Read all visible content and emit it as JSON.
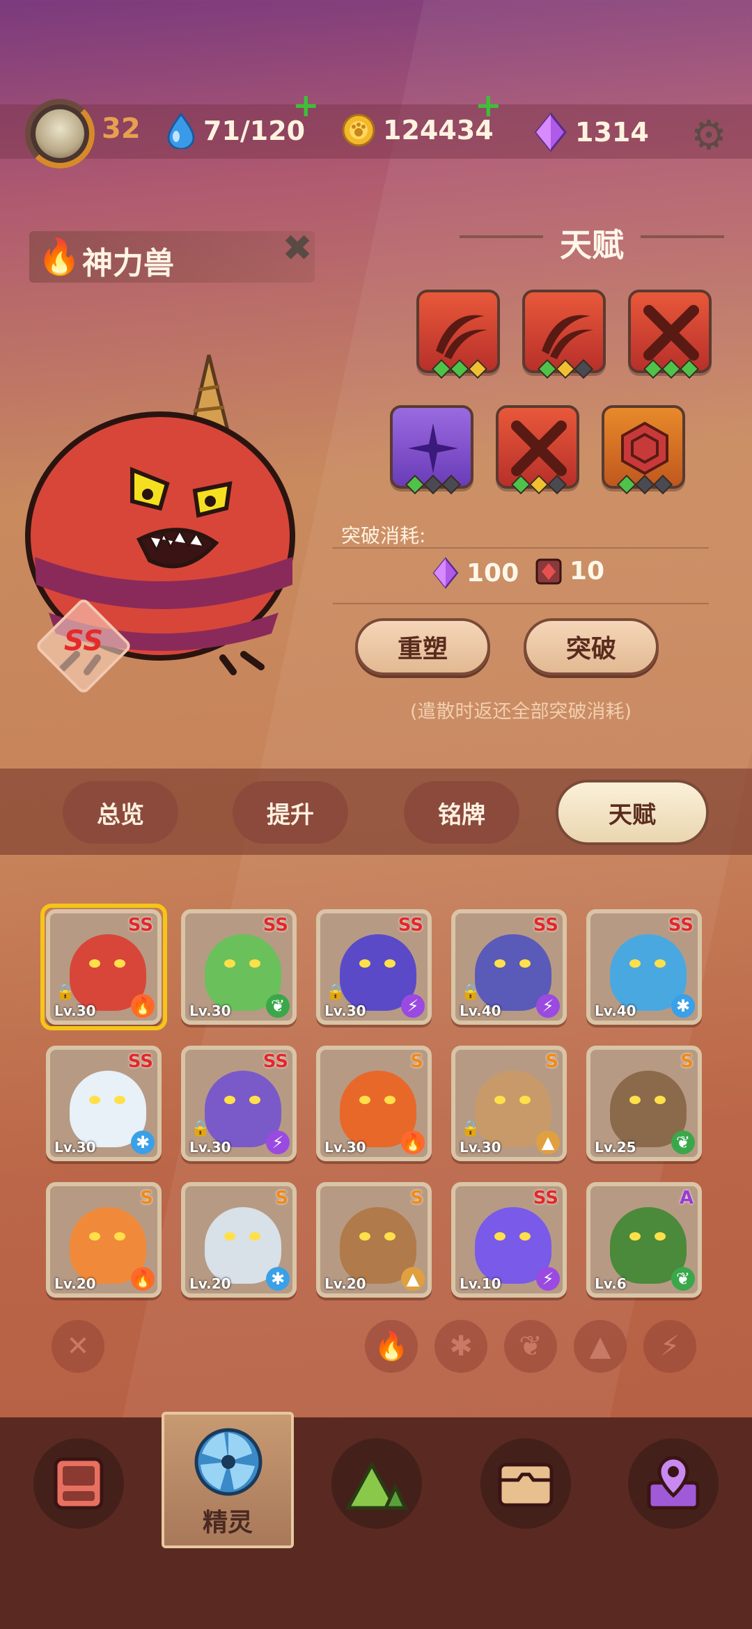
{
  "topbar": {
    "player_level": "32",
    "energy": "71/120",
    "coins": "124434",
    "gems": "1314"
  },
  "monster": {
    "name": "神力兽",
    "grade": "SS"
  },
  "talent": {
    "title": "天赋",
    "cost_label": "突破消耗:",
    "cost_gems": "100",
    "cost_items": "10",
    "reset_button": "重塑",
    "breakthrough_button": "突破",
    "note": "(遣散时返还全部突破消耗)"
  },
  "tabs": [
    "总览",
    "提升",
    "铭牌",
    "天赋"
  ],
  "creatures": [
    {
      "grade": "SS",
      "level": "Lv.30",
      "element": "fire",
      "locked": true
    },
    {
      "grade": "SS",
      "level": "Lv.30",
      "element": "leaf",
      "locked": false
    },
    {
      "grade": "SS",
      "level": "Lv.30",
      "element": "lightning",
      "locked": true
    },
    {
      "grade": "SS",
      "level": "Lv.40",
      "element": "lightning",
      "locked": true
    },
    {
      "grade": "SS",
      "level": "Lv.40",
      "element": "ice",
      "locked": false
    },
    {
      "grade": "SS",
      "level": "Lv.30",
      "element": "ice",
      "locked": false
    },
    {
      "grade": "SS",
      "level": "Lv.30",
      "element": "lightning",
      "locked": true
    },
    {
      "grade": "S",
      "level": "Lv.30",
      "element": "fire",
      "locked": false
    },
    {
      "grade": "S",
      "level": "Lv.30",
      "element": "rock",
      "locked": true
    },
    {
      "grade": "S",
      "level": "Lv.25",
      "element": "leaf",
      "locked": false
    },
    {
      "grade": "S",
      "level": "Lv.20",
      "element": "fire",
      "locked": false
    },
    {
      "grade": "S",
      "level": "Lv.20",
      "element": "ice",
      "locked": false
    },
    {
      "grade": "S",
      "level": "Lv.20",
      "element": "rock",
      "locked": false
    },
    {
      "grade": "SS",
      "level": "Lv.10",
      "element": "lightning",
      "locked": false
    },
    {
      "grade": "A",
      "level": "Lv.6",
      "element": "leaf",
      "locked": false
    }
  ],
  "bottom_nav": {
    "active_label": "精灵"
  },
  "colors": {
    "fire": "#ff6a2a",
    "leaf": "#3aa84a",
    "lightning": "#9a4ae0",
    "ice": "#3aa0e8",
    "rock": "#e0a040"
  }
}
